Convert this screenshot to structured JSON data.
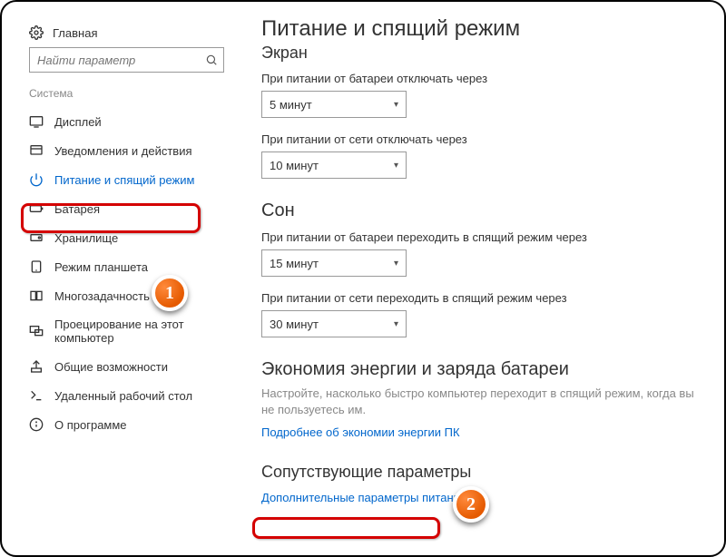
{
  "header": {
    "home": "Главная",
    "search_placeholder": "Найти параметр",
    "category": "Система"
  },
  "sidebar": {
    "items": [
      {
        "label": "Дисплей"
      },
      {
        "label": "Уведомления и действия"
      },
      {
        "label": "Питание и спящий режим"
      },
      {
        "label": "Батарея"
      },
      {
        "label": "Хранилище"
      },
      {
        "label": "Режим планшета"
      },
      {
        "label": "Многозадачность"
      },
      {
        "label": "Проецирование на этот компьютер"
      },
      {
        "label": "Общие возможности"
      },
      {
        "label": "Удаленный рабочий стол"
      },
      {
        "label": "О программе"
      }
    ]
  },
  "main": {
    "title": "Питание и спящий режим",
    "screen_heading": "Экран",
    "screen_battery_label": "При питании от батареи отключать через",
    "screen_battery_value": "5 минут",
    "screen_plugged_label": "При питании от сети отключать через",
    "screen_plugged_value": "10 минут",
    "sleep_heading": "Сон",
    "sleep_battery_label": "При питании от батареи переходить в спящий режим через",
    "sleep_battery_value": "15 минут",
    "sleep_plugged_label": "При питании от сети переходить в спящий режим через",
    "sleep_plugged_value": "30 минут",
    "energy_heading": "Экономия энергии и заряда батареи",
    "energy_desc": "Настройте, насколько быстро компьютер переходит в спящий режим, когда вы не пользуетесь им.",
    "energy_link": "Подробнее об экономии энергии ПК",
    "related_heading": "Сопутствующие параметры",
    "related_link": "Дополнительные параметры питания"
  },
  "badges": {
    "one": "1",
    "two": "2"
  }
}
